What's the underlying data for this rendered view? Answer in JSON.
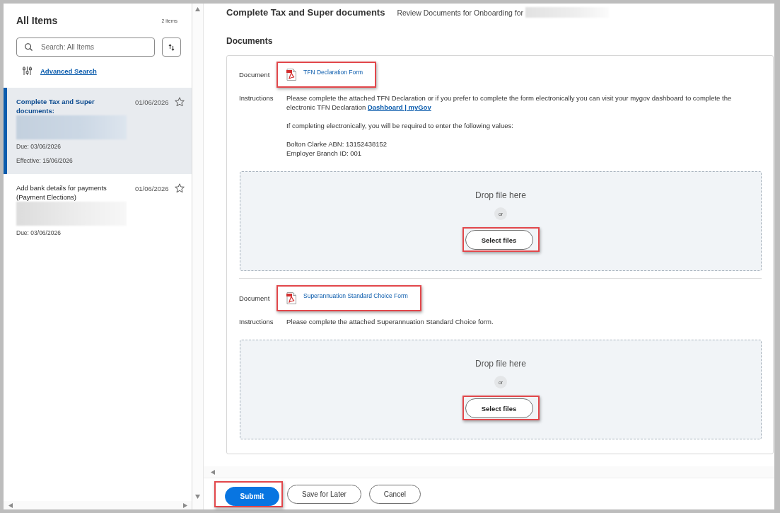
{
  "sidebar": {
    "title": "All Items",
    "count": "2 items",
    "search": {
      "placeholder": "Search: All Items"
    },
    "advanced_search": "Advanced Search",
    "items": [
      {
        "title": "Complete Tax and Super documents:",
        "date": "01/06/2026",
        "lines": [
          "Due: 03/06/2026",
          "Effective: 15/06/2026"
        ],
        "selected": true
      },
      {
        "title": "Add bank details for payments (Payment Elections)",
        "date": "01/06/2026",
        "lines": [
          "Due: 03/06/2026"
        ],
        "selected": false
      }
    ]
  },
  "header": {
    "title": "Complete Tax and Super documents",
    "subtitle": "Review Documents for Onboarding for"
  },
  "section_title": "Documents",
  "documents": [
    {
      "label": "Document",
      "file": "TFN Declaration Form",
      "file_highlighted": true,
      "instructions_label": "Instructions",
      "instructions": [
        {
          "lines": [
            "Please complete the attached TFN Declaration or if you prefer to complete the form electronically you can visit your mygov dashboard to complete the electronic TFN Declaration"
          ],
          "link": "Dashboard | myGov"
        },
        {
          "lines": [
            "If completing electronically, you will be required to enter the following values:"
          ]
        },
        {
          "lines": [
            "Bolton Clarke ABN: 13152438152",
            "Employer Branch ID: 001"
          ]
        }
      ],
      "drop_zone": {
        "text": "Drop file here",
        "or": "or",
        "button": "Select files",
        "button_highlighted": true
      }
    },
    {
      "label": "Document",
      "file": "Superannuation Standard Choice Form",
      "file_highlighted": true,
      "instructions_label": "Instructions",
      "instructions": [
        {
          "lines": [
            "Please complete the attached Superannuation Standard Choice form."
          ]
        }
      ],
      "drop_zone": {
        "text": "Drop file here",
        "or": "or",
        "button": "Select files",
        "button_highlighted": true
      }
    }
  ],
  "actions": [
    {
      "label": "Submit",
      "kind": "submit",
      "highlighted": true
    },
    {
      "label": "Save for Later",
      "kind": "save",
      "highlighted": false
    },
    {
      "label": "Cancel",
      "kind": "cancel",
      "highlighted": false
    }
  ]
}
